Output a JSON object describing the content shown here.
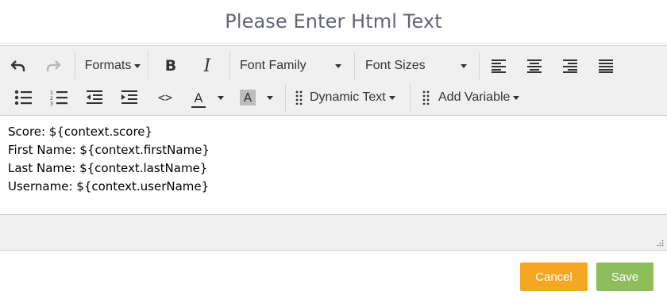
{
  "dialog": {
    "title": "Please Enter Html Text"
  },
  "toolbar": {
    "formats_label": "Formats",
    "bold_label": "B",
    "italic_label": "I",
    "font_family_label": "Font Family",
    "font_sizes_label": "Font Sizes",
    "code_label": "<>",
    "text_color_label": "A",
    "bg_color_label": "A",
    "dynamic_text_label": "Dynamic Text",
    "add_variable_label": "Add Variable"
  },
  "content": {
    "lines": [
      "Score: ${context.score}",
      "First Name: ${context.firstName}",
      "Last Name: ${context.lastName}",
      "Username: ${context.userName}"
    ]
  },
  "footer": {
    "cancel_label": "Cancel",
    "save_label": "Save"
  },
  "colors": {
    "cancel": "#f5a623",
    "save": "#8ebd5c",
    "title": "#5f6676",
    "toolbar_bg": "#f0f0f0"
  }
}
